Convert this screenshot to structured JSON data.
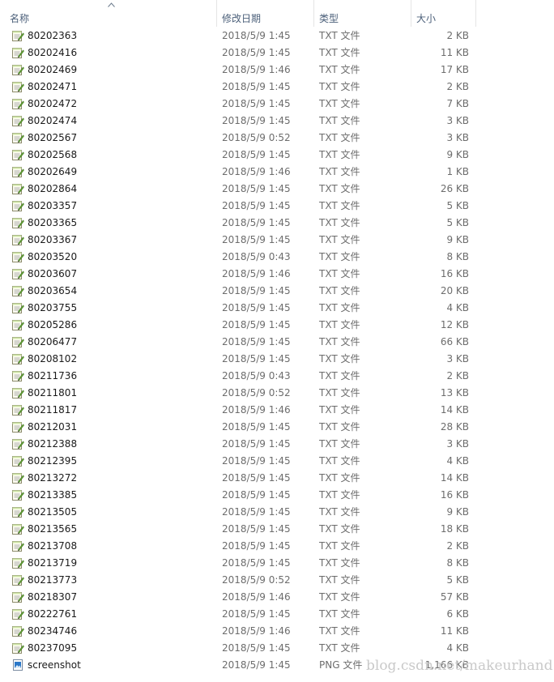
{
  "columns": {
    "name": "名称",
    "date": "修改日期",
    "type": "类型",
    "size": "大小"
  },
  "sort": {
    "column": "name",
    "direction": "ascending",
    "icon": "sort-up-arrow-icon"
  },
  "files": [
    {
      "name": "80202363",
      "date": "2018/5/9 1:45",
      "type": "TXT 文件",
      "size": "2 KB",
      "icon": "text-file-icon"
    },
    {
      "name": "80202416",
      "date": "2018/5/9 1:45",
      "type": "TXT 文件",
      "size": "11 KB",
      "icon": "text-file-icon"
    },
    {
      "name": "80202469",
      "date": "2018/5/9 1:46",
      "type": "TXT 文件",
      "size": "17 KB",
      "icon": "text-file-icon"
    },
    {
      "name": "80202471",
      "date": "2018/5/9 1:45",
      "type": "TXT 文件",
      "size": "2 KB",
      "icon": "text-file-icon"
    },
    {
      "name": "80202472",
      "date": "2018/5/9 1:45",
      "type": "TXT 文件",
      "size": "7 KB",
      "icon": "text-file-icon"
    },
    {
      "name": "80202474",
      "date": "2018/5/9 1:45",
      "type": "TXT 文件",
      "size": "3 KB",
      "icon": "text-file-icon"
    },
    {
      "name": "80202567",
      "date": "2018/5/9 0:52",
      "type": "TXT 文件",
      "size": "3 KB",
      "icon": "text-file-icon"
    },
    {
      "name": "80202568",
      "date": "2018/5/9 1:45",
      "type": "TXT 文件",
      "size": "9 KB",
      "icon": "text-file-icon"
    },
    {
      "name": "80202649",
      "date": "2018/5/9 1:46",
      "type": "TXT 文件",
      "size": "1 KB",
      "icon": "text-file-icon"
    },
    {
      "name": "80202864",
      "date": "2018/5/9 1:45",
      "type": "TXT 文件",
      "size": "26 KB",
      "icon": "text-file-icon"
    },
    {
      "name": "80203357",
      "date": "2018/5/9 1:45",
      "type": "TXT 文件",
      "size": "5 KB",
      "icon": "text-file-icon"
    },
    {
      "name": "80203365",
      "date": "2018/5/9 1:45",
      "type": "TXT 文件",
      "size": "5 KB",
      "icon": "text-file-icon"
    },
    {
      "name": "80203367",
      "date": "2018/5/9 1:45",
      "type": "TXT 文件",
      "size": "9 KB",
      "icon": "text-file-icon"
    },
    {
      "name": "80203520",
      "date": "2018/5/9 0:43",
      "type": "TXT 文件",
      "size": "8 KB",
      "icon": "text-file-icon"
    },
    {
      "name": "80203607",
      "date": "2018/5/9 1:46",
      "type": "TXT 文件",
      "size": "16 KB",
      "icon": "text-file-icon"
    },
    {
      "name": "80203654",
      "date": "2018/5/9 1:45",
      "type": "TXT 文件",
      "size": "20 KB",
      "icon": "text-file-icon"
    },
    {
      "name": "80203755",
      "date": "2018/5/9 1:45",
      "type": "TXT 文件",
      "size": "4 KB",
      "icon": "text-file-icon"
    },
    {
      "name": "80205286",
      "date": "2018/5/9 1:45",
      "type": "TXT 文件",
      "size": "12 KB",
      "icon": "text-file-icon"
    },
    {
      "name": "80206477",
      "date": "2018/5/9 1:45",
      "type": "TXT 文件",
      "size": "66 KB",
      "icon": "text-file-icon"
    },
    {
      "name": "80208102",
      "date": "2018/5/9 1:45",
      "type": "TXT 文件",
      "size": "3 KB",
      "icon": "text-file-icon"
    },
    {
      "name": "80211736",
      "date": "2018/5/9 0:43",
      "type": "TXT 文件",
      "size": "2 KB",
      "icon": "text-file-icon"
    },
    {
      "name": "80211801",
      "date": "2018/5/9 0:52",
      "type": "TXT 文件",
      "size": "13 KB",
      "icon": "text-file-icon"
    },
    {
      "name": "80211817",
      "date": "2018/5/9 1:46",
      "type": "TXT 文件",
      "size": "14 KB",
      "icon": "text-file-icon"
    },
    {
      "name": "80212031",
      "date": "2018/5/9 1:45",
      "type": "TXT 文件",
      "size": "28 KB",
      "icon": "text-file-icon"
    },
    {
      "name": "80212388",
      "date": "2018/5/9 1:45",
      "type": "TXT 文件",
      "size": "3 KB",
      "icon": "text-file-icon"
    },
    {
      "name": "80212395",
      "date": "2018/5/9 1:45",
      "type": "TXT 文件",
      "size": "4 KB",
      "icon": "text-file-icon"
    },
    {
      "name": "80213272",
      "date": "2018/5/9 1:45",
      "type": "TXT 文件",
      "size": "14 KB",
      "icon": "text-file-icon"
    },
    {
      "name": "80213385",
      "date": "2018/5/9 1:45",
      "type": "TXT 文件",
      "size": "16 KB",
      "icon": "text-file-icon"
    },
    {
      "name": "80213505",
      "date": "2018/5/9 1:45",
      "type": "TXT 文件",
      "size": "9 KB",
      "icon": "text-file-icon"
    },
    {
      "name": "80213565",
      "date": "2018/5/9 1:45",
      "type": "TXT 文件",
      "size": "18 KB",
      "icon": "text-file-icon"
    },
    {
      "name": "80213708",
      "date": "2018/5/9 1:45",
      "type": "TXT 文件",
      "size": "2 KB",
      "icon": "text-file-icon"
    },
    {
      "name": "80213719",
      "date": "2018/5/9 1:45",
      "type": "TXT 文件",
      "size": "8 KB",
      "icon": "text-file-icon"
    },
    {
      "name": "80213773",
      "date": "2018/5/9 0:52",
      "type": "TXT 文件",
      "size": "5 KB",
      "icon": "text-file-icon"
    },
    {
      "name": "80218307",
      "date": "2018/5/9 1:46",
      "type": "TXT 文件",
      "size": "57 KB",
      "icon": "text-file-icon"
    },
    {
      "name": "80222761",
      "date": "2018/5/9 1:45",
      "type": "TXT 文件",
      "size": "6 KB",
      "icon": "text-file-icon"
    },
    {
      "name": "80234746",
      "date": "2018/5/9 1:46",
      "type": "TXT 文件",
      "size": "11 KB",
      "icon": "text-file-icon"
    },
    {
      "name": "80237095",
      "date": "2018/5/9 1:45",
      "type": "TXT 文件",
      "size": "4 KB",
      "icon": "text-file-icon"
    },
    {
      "name": "screenshot",
      "date": "2018/5/9 1:45",
      "type": "PNG 文件",
      "size": "1,166 KB",
      "icon": "image-file-icon"
    }
  ],
  "watermark": "blog.csdn.net/makeurhand",
  "colors": {
    "header_text": "#4c607a",
    "name_text": "#1a1a1a",
    "detail_text": "#6d6d6d",
    "separator": "#e5e5e5",
    "watermark": "#c9c9c9"
  }
}
